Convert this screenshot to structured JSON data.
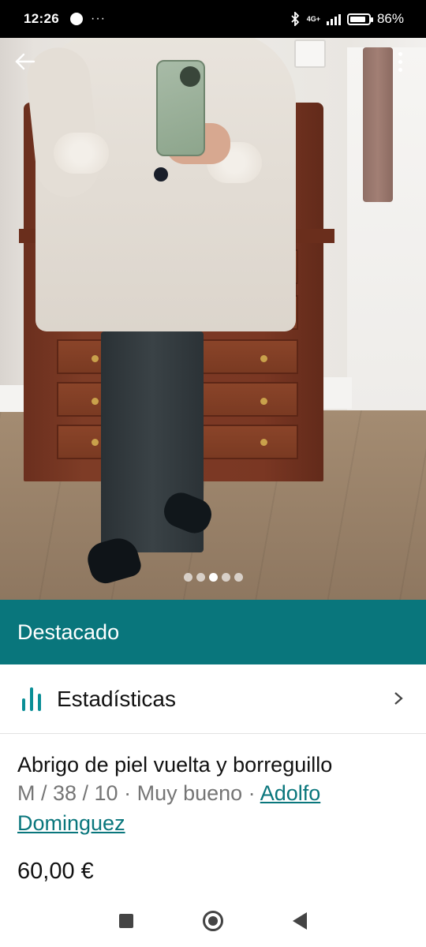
{
  "status_bar": {
    "time": "12:26",
    "more": "···",
    "network": "4G+",
    "battery_percent": "86%",
    "battery_level": 0.86
  },
  "gallery": {
    "image_count": 5,
    "active_index": 2
  },
  "banner": {
    "label": "Destacado"
  },
  "stats": {
    "label": "Estadísticas"
  },
  "product": {
    "title": "Abrigo de piel vuelta y borreguillo",
    "size": "M / 38 / 10",
    "separator": " · ",
    "condition": "Muy bueno",
    "brand": "Adolfo Dominguez",
    "price": "60,00 €"
  },
  "colors": {
    "accent": "#09767c",
    "banner_bg": "#09767c",
    "muted_text": "#757575"
  },
  "icons": {
    "back": "arrow-left-icon",
    "menu": "more-vertical-icon",
    "stats": "bar-chart-icon",
    "chevron": "chevron-right-icon"
  }
}
